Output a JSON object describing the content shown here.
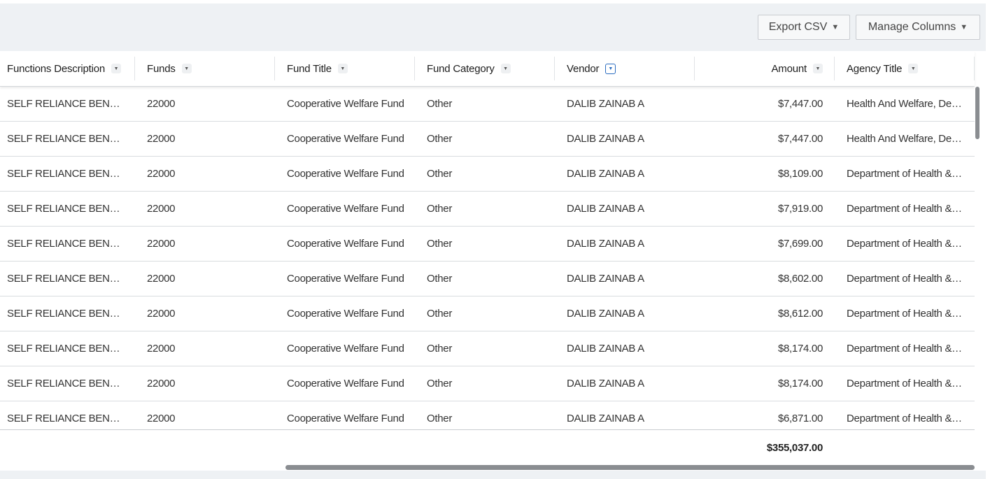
{
  "toolbar": {
    "export_label": "Export CSV",
    "manage_label": "Manage Columns"
  },
  "columns": [
    {
      "key": "func",
      "label": "Functions Description"
    },
    {
      "key": "funds",
      "label": "Funds"
    },
    {
      "key": "ftitle",
      "label": "Fund Title"
    },
    {
      "key": "fcat",
      "label": "Fund Category"
    },
    {
      "key": "vendor",
      "label": "Vendor"
    },
    {
      "key": "amount",
      "label": "Amount"
    },
    {
      "key": "agency",
      "label": "Agency Title"
    }
  ],
  "rows": [
    {
      "func": "SELF RELIANCE BENEFITS",
      "funds": "22000",
      "ftitle": "Cooperative Welfare Fund",
      "fcat": "Other",
      "vendor": "DALIB ZAINAB A",
      "amount": "$7,447.00",
      "agency": "Health And Welfare, Department of"
    },
    {
      "func": "SELF RELIANCE BENEFITS",
      "funds": "22000",
      "ftitle": "Cooperative Welfare Fund",
      "fcat": "Other",
      "vendor": "DALIB ZAINAB A",
      "amount": "$7,447.00",
      "agency": "Health And Welfare, Department of"
    },
    {
      "func": "SELF RELIANCE BENEFITS",
      "funds": "22000",
      "ftitle": "Cooperative Welfare Fund",
      "fcat": "Other",
      "vendor": "DALIB ZAINAB A",
      "amount": "$8,109.00",
      "agency": "Department of Health & Welfare"
    },
    {
      "func": "SELF RELIANCE BENEFITS",
      "funds": "22000",
      "ftitle": "Cooperative Welfare Fund",
      "fcat": "Other",
      "vendor": "DALIB ZAINAB A",
      "amount": "$7,919.00",
      "agency": "Department of Health & Welfare"
    },
    {
      "func": "SELF RELIANCE BENEFITS",
      "funds": "22000",
      "ftitle": "Cooperative Welfare Fund",
      "fcat": "Other",
      "vendor": "DALIB ZAINAB A",
      "amount": "$7,699.00",
      "agency": "Department of Health & Welfare"
    },
    {
      "func": "SELF RELIANCE BENEFITS",
      "funds": "22000",
      "ftitle": "Cooperative Welfare Fund",
      "fcat": "Other",
      "vendor": "DALIB ZAINAB A",
      "amount": "$8,602.00",
      "agency": "Department of Health & Welfare"
    },
    {
      "func": "SELF RELIANCE BENEFITS",
      "funds": "22000",
      "ftitle": "Cooperative Welfare Fund",
      "fcat": "Other",
      "vendor": "DALIB ZAINAB A",
      "amount": "$8,612.00",
      "agency": "Department of Health & Welfare"
    },
    {
      "func": "SELF RELIANCE BENEFITS",
      "funds": "22000",
      "ftitle": "Cooperative Welfare Fund",
      "fcat": "Other",
      "vendor": "DALIB ZAINAB A",
      "amount": "$8,174.00",
      "agency": "Department of Health & Welfare"
    },
    {
      "func": "SELF RELIANCE BENEFITS",
      "funds": "22000",
      "ftitle": "Cooperative Welfare Fund",
      "fcat": "Other",
      "vendor": "DALIB ZAINAB A",
      "amount": "$8,174.00",
      "agency": "Department of Health & Welfare"
    },
    {
      "func": "SELF RELIANCE BENEFITS",
      "funds": "22000",
      "ftitle": "Cooperative Welfare Fund",
      "fcat": "Other",
      "vendor": "DALIB ZAINAB A",
      "amount": "$6,871.00",
      "agency": "Department of Health & Welfare"
    }
  ],
  "totals": {
    "amount": "$355,037.00"
  },
  "active_sort_column": "vendor",
  "colors": {
    "toolbar_bg": "#eef1f4",
    "accent": "#2a6cc0",
    "scrollbar": "#8a8d91"
  },
  "icons": {
    "sort": "sort-toggle-icon",
    "caret": "caret-down-icon"
  }
}
